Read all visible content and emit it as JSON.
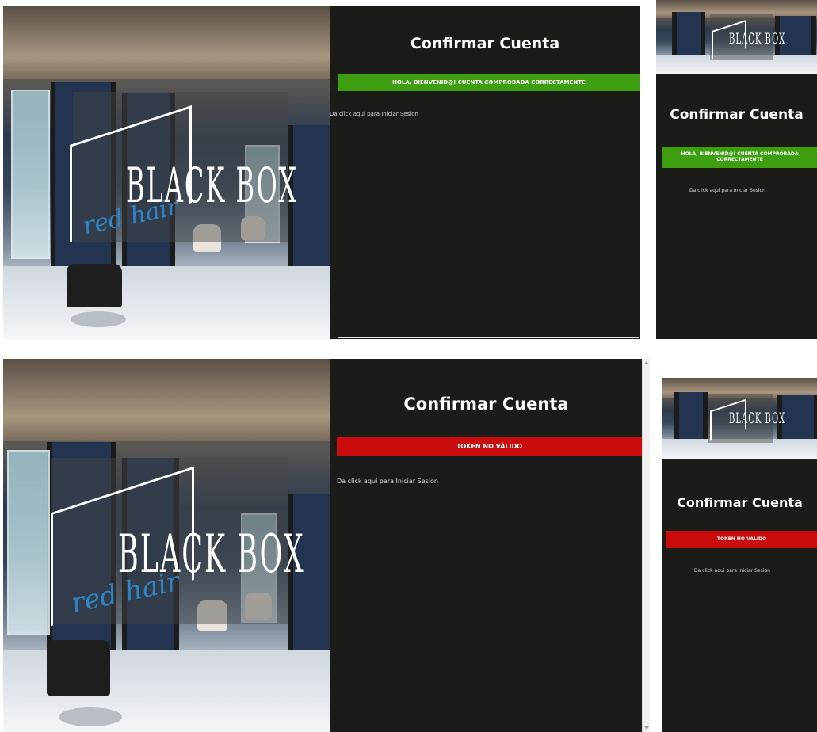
{
  "brand": {
    "logo_main": "BLACK BOX",
    "logo_script": "red hair"
  },
  "screens": [
    {
      "id": "success_desktop",
      "title": "Confirmar Cuenta",
      "alert": "HOLA, BIENVENID@! CUENTA COMPROBADA CORRECTAMENTE",
      "alert_status": "success",
      "login_link": "Da click aqui para Iniciar Sesion"
    },
    {
      "id": "success_mobile",
      "title": "Confirmar Cuenta",
      "alert": "HOLA, BIENVENID@! CUENTA COMPROBADA CORRECTAMENTE",
      "alert_status": "success",
      "login_link": "Da click aqui para Iniciar Sesion"
    },
    {
      "id": "error_desktop",
      "title": "Confirmar Cuenta",
      "alert": "TOKEN NO VÁLIDO",
      "alert_status": "error",
      "login_link": "Da click aqui para Iniciar Sesion"
    },
    {
      "id": "error_mobile",
      "title": "Confirmar Cuenta",
      "alert": "TOKEN NO VÁLIDO",
      "alert_status": "error",
      "login_link": "Da click aqui para Iniciar Sesion"
    }
  ],
  "colors": {
    "panel_bg": "#1b1b18",
    "success": "#3d9e0f",
    "error": "#c90b0b",
    "logo_script": "#2f84c6"
  }
}
